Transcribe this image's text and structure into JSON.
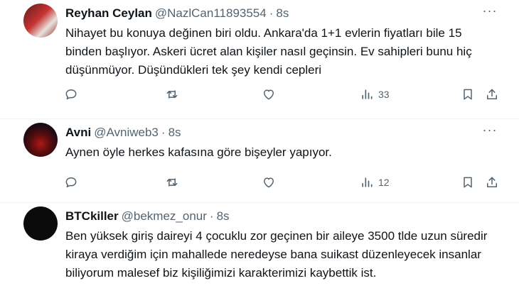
{
  "tweets": [
    {
      "name": "Reyhan Ceylan",
      "handle": "@NazlCan11893554",
      "separator": "·",
      "time": "8s",
      "text": "Nihayet bu konuya değinen biri oldu. Ankara'da 1+1 evlerin fiyatları bile 15 binden başlıyor. Askeri ücret alan kişiler nasıl geçinsin. Ev sahipleri bunu hiç düşünmüyor. Düşündükleri tek şey kendi cepleri",
      "views": "33"
    },
    {
      "name": "Avni",
      "handle": "@Avniweb3",
      "separator": "·",
      "time": "8s",
      "text": "Aynen öyle herkes kafasına göre bişeyler yapıyor.",
      "views": "12"
    },
    {
      "name": "BTCkiller",
      "handle": "@bekmez_onur",
      "separator": "·",
      "time": "8s",
      "text": "Ben yüksek giriş daireyi 4 çocuklu zor geçinen bir aileye 3500 tlde uzun süredir kiraya verdiğim için mahallede neredeyse bana suikast düzenleyecek insanlar biliyorum malesef biz kişiliğimizi karakterimizi kaybettik ist."
    }
  ],
  "icons": {
    "reply": "comment-bubble-icon",
    "retweet": "retweet-arrows-icon",
    "like": "heart-icon",
    "views": "bar-chart-icon",
    "bookmark": "bookmark-icon",
    "share": "share-upload-icon",
    "more": "more-dots-icon"
  },
  "colors": {
    "text": "#0f1419",
    "secondary": "#536471",
    "divider": "#eff3f4"
  }
}
